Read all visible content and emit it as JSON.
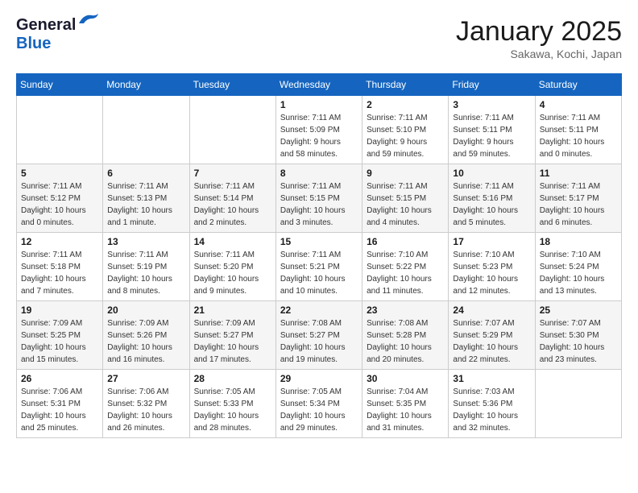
{
  "header": {
    "logo_general": "General",
    "logo_blue": "Blue",
    "month": "January 2025",
    "location": "Sakawa, Kochi, Japan"
  },
  "weekdays": [
    "Sunday",
    "Monday",
    "Tuesday",
    "Wednesday",
    "Thursday",
    "Friday",
    "Saturday"
  ],
  "weeks": [
    [
      {
        "day": "",
        "info": ""
      },
      {
        "day": "",
        "info": ""
      },
      {
        "day": "",
        "info": ""
      },
      {
        "day": "1",
        "info": "Sunrise: 7:11 AM\nSunset: 5:09 PM\nDaylight: 9 hours\nand 58 minutes."
      },
      {
        "day": "2",
        "info": "Sunrise: 7:11 AM\nSunset: 5:10 PM\nDaylight: 9 hours\nand 59 minutes."
      },
      {
        "day": "3",
        "info": "Sunrise: 7:11 AM\nSunset: 5:11 PM\nDaylight: 9 hours\nand 59 minutes."
      },
      {
        "day": "4",
        "info": "Sunrise: 7:11 AM\nSunset: 5:11 PM\nDaylight: 10 hours\nand 0 minutes."
      }
    ],
    [
      {
        "day": "5",
        "info": "Sunrise: 7:11 AM\nSunset: 5:12 PM\nDaylight: 10 hours\nand 0 minutes."
      },
      {
        "day": "6",
        "info": "Sunrise: 7:11 AM\nSunset: 5:13 PM\nDaylight: 10 hours\nand 1 minute."
      },
      {
        "day": "7",
        "info": "Sunrise: 7:11 AM\nSunset: 5:14 PM\nDaylight: 10 hours\nand 2 minutes."
      },
      {
        "day": "8",
        "info": "Sunrise: 7:11 AM\nSunset: 5:15 PM\nDaylight: 10 hours\nand 3 minutes."
      },
      {
        "day": "9",
        "info": "Sunrise: 7:11 AM\nSunset: 5:15 PM\nDaylight: 10 hours\nand 4 minutes."
      },
      {
        "day": "10",
        "info": "Sunrise: 7:11 AM\nSunset: 5:16 PM\nDaylight: 10 hours\nand 5 minutes."
      },
      {
        "day": "11",
        "info": "Sunrise: 7:11 AM\nSunset: 5:17 PM\nDaylight: 10 hours\nand 6 minutes."
      }
    ],
    [
      {
        "day": "12",
        "info": "Sunrise: 7:11 AM\nSunset: 5:18 PM\nDaylight: 10 hours\nand 7 minutes."
      },
      {
        "day": "13",
        "info": "Sunrise: 7:11 AM\nSunset: 5:19 PM\nDaylight: 10 hours\nand 8 minutes."
      },
      {
        "day": "14",
        "info": "Sunrise: 7:11 AM\nSunset: 5:20 PM\nDaylight: 10 hours\nand 9 minutes."
      },
      {
        "day": "15",
        "info": "Sunrise: 7:11 AM\nSunset: 5:21 PM\nDaylight: 10 hours\nand 10 minutes."
      },
      {
        "day": "16",
        "info": "Sunrise: 7:10 AM\nSunset: 5:22 PM\nDaylight: 10 hours\nand 11 minutes."
      },
      {
        "day": "17",
        "info": "Sunrise: 7:10 AM\nSunset: 5:23 PM\nDaylight: 10 hours\nand 12 minutes."
      },
      {
        "day": "18",
        "info": "Sunrise: 7:10 AM\nSunset: 5:24 PM\nDaylight: 10 hours\nand 13 minutes."
      }
    ],
    [
      {
        "day": "19",
        "info": "Sunrise: 7:09 AM\nSunset: 5:25 PM\nDaylight: 10 hours\nand 15 minutes."
      },
      {
        "day": "20",
        "info": "Sunrise: 7:09 AM\nSunset: 5:26 PM\nDaylight: 10 hours\nand 16 minutes."
      },
      {
        "day": "21",
        "info": "Sunrise: 7:09 AM\nSunset: 5:27 PM\nDaylight: 10 hours\nand 17 minutes."
      },
      {
        "day": "22",
        "info": "Sunrise: 7:08 AM\nSunset: 5:27 PM\nDaylight: 10 hours\nand 19 minutes."
      },
      {
        "day": "23",
        "info": "Sunrise: 7:08 AM\nSunset: 5:28 PM\nDaylight: 10 hours\nand 20 minutes."
      },
      {
        "day": "24",
        "info": "Sunrise: 7:07 AM\nSunset: 5:29 PM\nDaylight: 10 hours\nand 22 minutes."
      },
      {
        "day": "25",
        "info": "Sunrise: 7:07 AM\nSunset: 5:30 PM\nDaylight: 10 hours\nand 23 minutes."
      }
    ],
    [
      {
        "day": "26",
        "info": "Sunrise: 7:06 AM\nSunset: 5:31 PM\nDaylight: 10 hours\nand 25 minutes."
      },
      {
        "day": "27",
        "info": "Sunrise: 7:06 AM\nSunset: 5:32 PM\nDaylight: 10 hours\nand 26 minutes."
      },
      {
        "day": "28",
        "info": "Sunrise: 7:05 AM\nSunset: 5:33 PM\nDaylight: 10 hours\nand 28 minutes."
      },
      {
        "day": "29",
        "info": "Sunrise: 7:05 AM\nSunset: 5:34 PM\nDaylight: 10 hours\nand 29 minutes."
      },
      {
        "day": "30",
        "info": "Sunrise: 7:04 AM\nSunset: 5:35 PM\nDaylight: 10 hours\nand 31 minutes."
      },
      {
        "day": "31",
        "info": "Sunrise: 7:03 AM\nSunset: 5:36 PM\nDaylight: 10 hours\nand 32 minutes."
      },
      {
        "day": "",
        "info": ""
      }
    ]
  ]
}
